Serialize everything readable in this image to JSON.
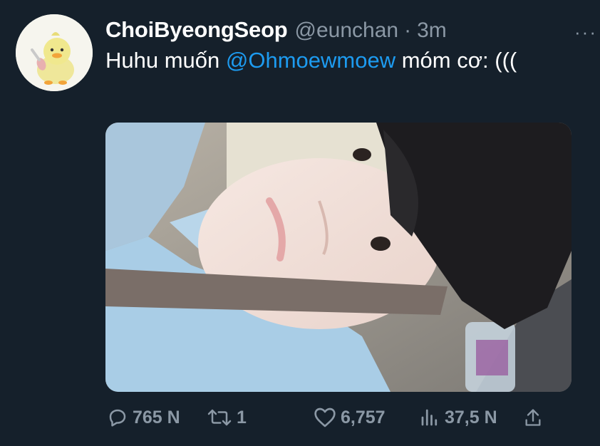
{
  "tweet": {
    "display_name": "ChoiByeongSeop",
    "handle": "@eunchan",
    "separator": "·",
    "time": "3m",
    "more": "···",
    "text_before": "Huhu muốn ",
    "mention": "@Ohmoewmoew",
    "text_after": " móm cơ: (((",
    "avatar_icon": "duck-avatar",
    "photo_description": "selfie-photo"
  },
  "actions": {
    "reply_count": "765 N",
    "retweet_count": "1",
    "like_count": "6,757",
    "views_count": "37,5 N"
  },
  "colors": {
    "background": "#15202b",
    "text": "#ffffff",
    "secondary": "#8b98a5",
    "accent": "#1d9bf0"
  }
}
